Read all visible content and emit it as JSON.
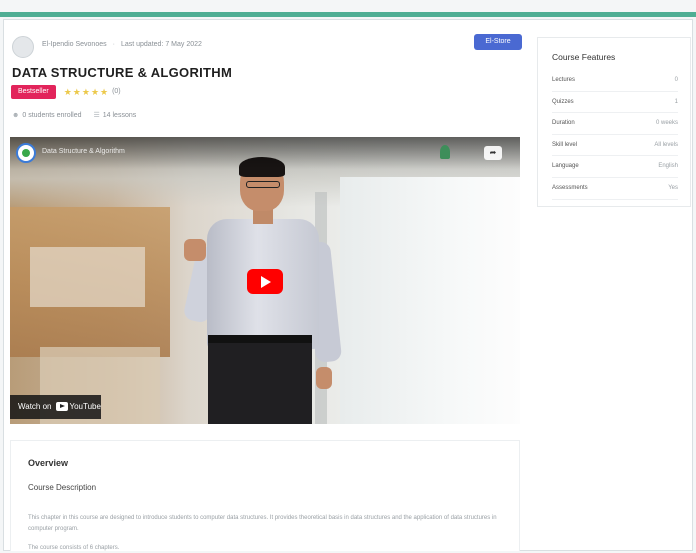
{
  "meta": {
    "instructor": "El-Ipendio Sevonoes",
    "updated": "Last updated: 7 May 2022",
    "action_button": "El-Store"
  },
  "course": {
    "title": "DATA STRUCTURE & ALGORITHM",
    "badge": "Bestseller",
    "stars": "★★★★★",
    "rating": "(0)",
    "students": "0 students enrolled",
    "lessons": "14 lessons"
  },
  "video": {
    "title": "Data Structure & Algorithm",
    "watch_on_prefix": "Watch on",
    "watch_on_brand": "YouTube"
  },
  "overview": {
    "title": "Overview",
    "subtitle": "Course Description",
    "paragraph": "This chapter in this course are designed to introduce students to computer data structures. It provides theoretical basis in data structures and the application of data structures in computer program.",
    "more": "The course consists of 6 chapters."
  },
  "features": {
    "title": "Course Features",
    "rows": [
      {
        "label": "Lectures",
        "value": "0"
      },
      {
        "label": "Quizzes",
        "value": "1"
      },
      {
        "label": "Duration",
        "value": "0 weeks"
      },
      {
        "label": "Skill level",
        "value": "All levels"
      },
      {
        "label": "Language",
        "value": "English"
      },
      {
        "label": "Assessments",
        "value": "Yes"
      }
    ]
  },
  "colors": {
    "accent_bar": "#4fae94",
    "badge": "#e2245b",
    "button": "#4a69d2",
    "play": "#ff0000"
  },
  "icons": {
    "students": "user-icon",
    "lessons": "file-icon",
    "share": "share-icon",
    "play": "play-icon"
  }
}
